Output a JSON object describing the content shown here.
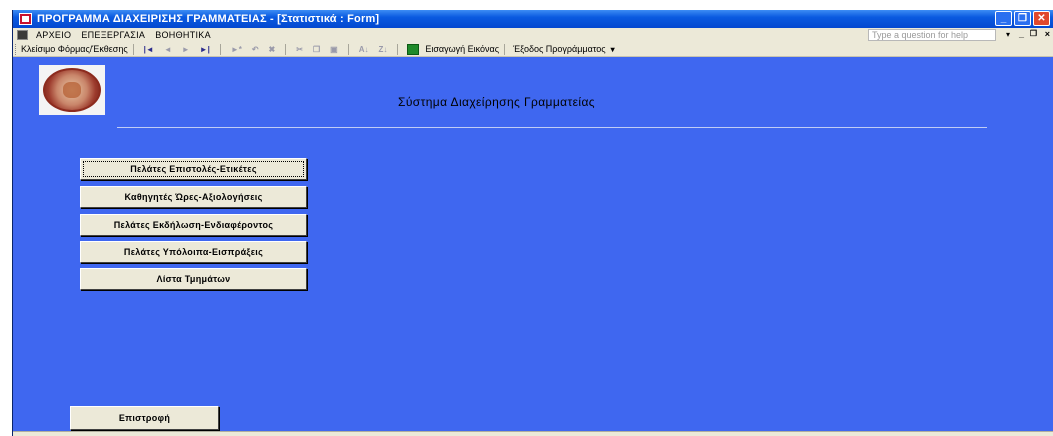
{
  "window": {
    "title": "ΠΡΟΓΡΑΜΜΑ ΔΙΑΧΕΙΡΙΣΗΣ ΓΡΑΜΜΑΤΕΙΑΣ - [Στατιστικά : Form]",
    "controls": {
      "minimize": "_",
      "restore": "❐",
      "close": "✕"
    }
  },
  "menubar": {
    "items": [
      "ΑΡΧΕΙΟ",
      "ΕΠΕΞΕΡΓΑΣΙΑ",
      "ΒΟΗΘΗΤΙΚΑ"
    ],
    "help_placeholder": "Type a question for help",
    "mdi_minimize": "_",
    "mdi_restore": "ð",
    "mdi_close": "×"
  },
  "toolbar": {
    "close_form": "Κλείσιμο Φόρμας/Έκθεσης",
    "insert_image": "Εισαγωγή Εικόνας",
    "exit_program": "Έξοδος Προγράμματος"
  },
  "form": {
    "title": "Σύστημα Διαχείρησης Γραμματείας",
    "buttons": [
      "Πελάτες Επιστολές-Ετικέτες",
      "Καθηγητές Ώρες-Αξιολογήσεις",
      "Πελάτες Εκδήλωση-Ενδιαφέροντος",
      "Πελάτες Υπόλοιπα-Εισπράξεις",
      "Λίστα Τμημάτων"
    ],
    "back_button": "Επιστροφή"
  },
  "colors": {
    "form_background": "#3f67f0",
    "titlebar": "#0a5ae0",
    "chrome": "#ece9d8"
  }
}
